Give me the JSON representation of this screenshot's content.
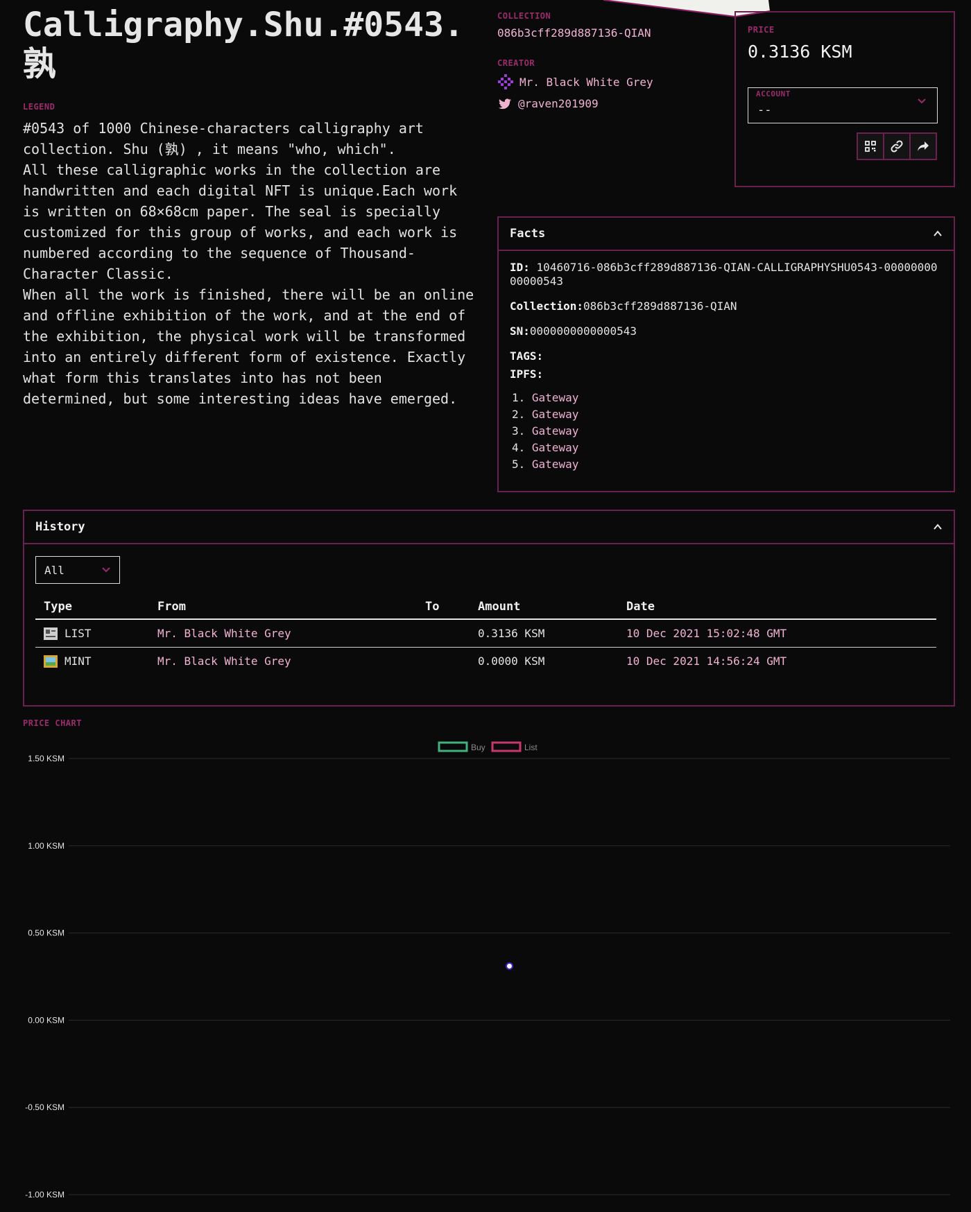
{
  "nft": {
    "title": "Calligraphy.Shu.#0543.孰",
    "legend_label": "LEGEND",
    "description": "#0543 of 1000 Chinese-characters calligraphy art collection. Shu (孰) , it means \"who, which\".\nAll these calligraphic works in the collection are handwritten and each digital NFT is unique.Each work is written on 68×68cm paper. The seal is specially customized for this group of works, and each work is numbered according to the sequence of Thousand-Character Classic.\nWhen all the work is finished, there will be an online and offline exhibition of the work, and at the end of the exhibition, the physical work will be transformed into an entirely different form of existence. Exactly what form this translates into has not been determined, but some interesting ideas have emerged."
  },
  "collection": {
    "label": "COLLECTION",
    "value": "086b3cff289d887136-QIAN"
  },
  "creator": {
    "label": "CREATOR",
    "name": "Mr. Black White Grey",
    "twitter": "@raven201909",
    "icon": "identicon-icon"
  },
  "price_box": {
    "label": "PRICE",
    "value": "0.3136 KSM",
    "account_label": "ACCOUNT",
    "account_value": "--",
    "buttons": [
      "qr-code-icon",
      "link-icon",
      "share-icon"
    ]
  },
  "facts": {
    "title": "Facts",
    "id_label": "ID:",
    "id_value": "10460716-086b3cff289d887136-QIAN-CALLIGRAPHYSHU0543-0000000000000543",
    "collection_label": "Collection:",
    "collection_value": "086b3cff289d887136-QIAN",
    "sn_label": "SN:",
    "sn_value": "0000000000000543",
    "tags_label": "TAGS:",
    "ipfs_label": "IPFS:",
    "gateways": [
      {
        "num": "1.",
        "label": "Gateway"
      },
      {
        "num": "2.",
        "label": "Gateway"
      },
      {
        "num": "3.",
        "label": "Gateway"
      },
      {
        "num": "4.",
        "label": "Gateway"
      },
      {
        "num": "5.",
        "label": "Gateway"
      }
    ]
  },
  "history": {
    "title": "History",
    "filter_value": "All",
    "columns": [
      "Type",
      "From",
      "To",
      "Amount",
      "Date"
    ],
    "rows": [
      {
        "icon": "newspaper-icon",
        "type": "LIST",
        "from": "Mr. Black White Grey",
        "to": "",
        "amount": "0.3136 KSM",
        "date": "10 Dec 2021 15:02:48 GMT"
      },
      {
        "icon": "framed-picture-icon",
        "type": "MINT",
        "from": "Mr. Black White Grey",
        "to": "",
        "amount": "0.0000 KSM",
        "date": "10 Dec 2021 14:56:24 GMT"
      }
    ]
  },
  "colors": {
    "accent": "#9b2b6d",
    "border": "#6b2150",
    "link": "#f2b3d3",
    "buy": "#3fb27f",
    "list": "#c8386f"
  },
  "chart_data": {
    "type": "scatter",
    "title": "PRICE CHART",
    "legend": [
      "Buy",
      "List"
    ],
    "legend_position": "top-center",
    "y_ticks": [
      "1.50 KSM",
      "1.00 KSM",
      "0.50 KSM",
      "0.00 KSM",
      "-0.50 KSM",
      "-1.00 KSM"
    ],
    "y_tick_values": [
      1.5,
      1.0,
      0.5,
      0.0,
      -0.5,
      -1.0
    ],
    "ylim": [
      -1.0,
      1.5
    ],
    "grid": true,
    "series": [
      {
        "name": "Buy",
        "values": []
      },
      {
        "name": "List",
        "values": [
          {
            "x": 0.5,
            "y": 0.31
          }
        ]
      }
    ]
  }
}
